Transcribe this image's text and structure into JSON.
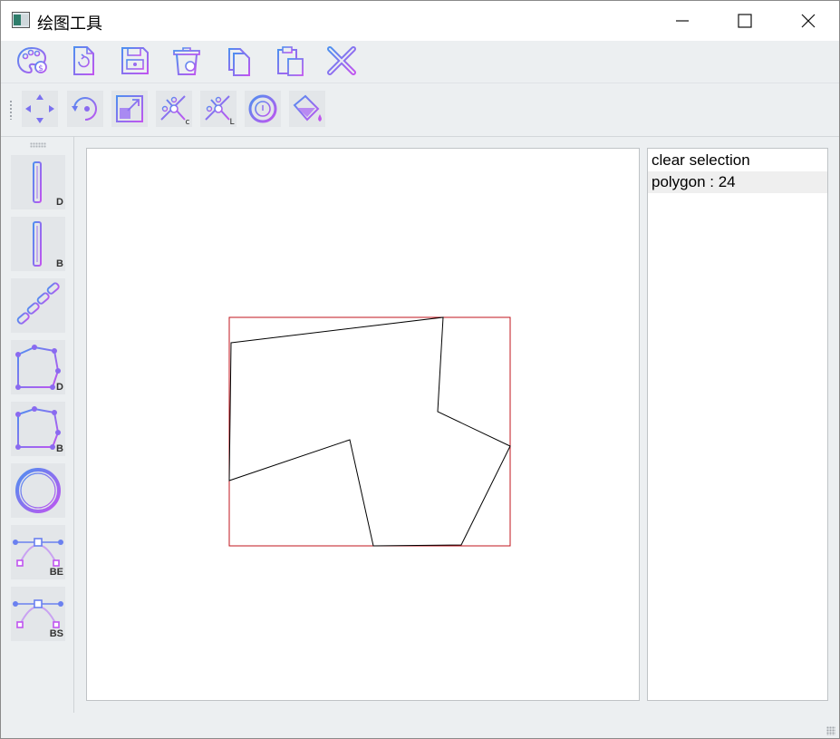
{
  "window": {
    "title": "绘图工具"
  },
  "icons": {
    "minimize": "minimize-icon",
    "maximize": "maximize-icon",
    "close": "close-icon",
    "toolbar1": [
      "palette-icon",
      "reload-file-icon",
      "save-icon",
      "recycle-bin-icon",
      "copy-icon",
      "paste-icon",
      "delete-x-icon"
    ],
    "toolbar2": [
      "move-icon",
      "rotate-icon",
      "scale-icon",
      "cut-c-icon",
      "cut-l-icon",
      "ring-icon",
      "fill-bucket-icon"
    ]
  },
  "left_tools": [
    {
      "name": "line-d",
      "badge": "D"
    },
    {
      "name": "line-b",
      "badge": "B"
    },
    {
      "name": "dash-line",
      "badge": ""
    },
    {
      "name": "polygon-d",
      "badge": "D"
    },
    {
      "name": "polygon-b",
      "badge": "B"
    },
    {
      "name": "circle",
      "badge": ""
    },
    {
      "name": "curve-be",
      "badge": "BE"
    },
    {
      "name": "curve-bs",
      "badge": "BS"
    }
  ],
  "list": {
    "items": [
      "clear selection",
      "polygon : 24"
    ],
    "selected_index": 1
  },
  "colors": {
    "accent_blue": "#5b8def",
    "accent_purple": "#b455f0",
    "selection_box": "#c0141c",
    "shape_stroke": "#000000"
  }
}
